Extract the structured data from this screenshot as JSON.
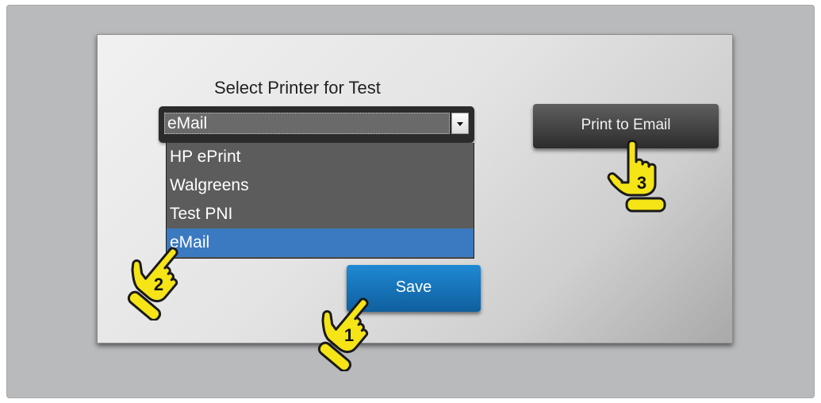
{
  "form": {
    "title": "Select Printer for Test",
    "select_value": "eMail",
    "options": [
      {
        "label": "HP ePrint",
        "selected": false
      },
      {
        "label": "Walgreens",
        "selected": false
      },
      {
        "label": "Test PNI",
        "selected": false
      },
      {
        "label": "eMail",
        "selected": true
      }
    ],
    "save_label": "Save",
    "print_email_label": "Print to Email"
  },
  "steps": [
    {
      "number": "1",
      "icon": "pointing-hand-icon"
    },
    {
      "number": "2",
      "icon": "pointing-hand-icon"
    },
    {
      "number": "3",
      "icon": "pointing-hand-icon"
    }
  ],
  "colors": {
    "accent": "#3b79c1",
    "save_button": "#1674bc",
    "callout": "#f5e416"
  }
}
